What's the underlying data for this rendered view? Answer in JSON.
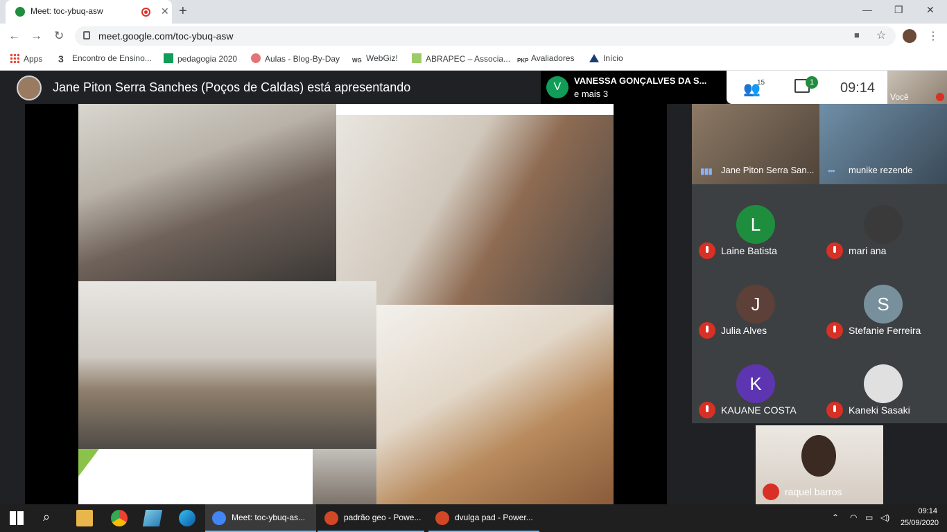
{
  "browser": {
    "tab_title": "Meet: toc-ybuq-asw",
    "tab_close": "✕",
    "new_tab": "+",
    "url": "meet.google.com/toc-ybuq-asw",
    "window_minimize": "—",
    "window_restore": "❐",
    "window_close": "✕"
  },
  "bookmarks": [
    {
      "label": "Apps",
      "icon": "apps-grid-icon"
    },
    {
      "label": "Encontro de Ensino...",
      "icon": "number-3-icon"
    },
    {
      "label": "pedagogia 2020",
      "icon": "sheets-icon"
    },
    {
      "label": "Aulas - Blog-By-Day",
      "icon": "blog-icon"
    },
    {
      "label": "WebGiz!",
      "icon": "wg-icon"
    },
    {
      "label": "ABRAPEC – Associa...",
      "icon": "abrapec-icon"
    },
    {
      "label": "Avaliadores",
      "icon": "pkp-icon"
    },
    {
      "label": "Início",
      "icon": "home-icon"
    }
  ],
  "meet": {
    "presenting_text": "Jane Piton Serra Sanches (Poços de Caldas) está apresentando",
    "chip": {
      "initial": "V",
      "name": "VANESSA GONÇALVES DA S...",
      "more": "e mais 3"
    },
    "people_count": "15",
    "chat_badge": "1",
    "clock": "09:14",
    "self_label": "Você",
    "video_tiles": [
      {
        "name": "Jane Piton Serra San..."
      },
      {
        "name": "munike rezende"
      }
    ],
    "participants": [
      {
        "initial": "L",
        "name": "Laine Batista",
        "color": "#1e8e3e"
      },
      {
        "initial": "",
        "name": "mari ana",
        "color": "#3a3a3a"
      },
      {
        "initial": "J",
        "name": "Julia Alves",
        "color": "#5d4037"
      },
      {
        "initial": "S",
        "name": "Stefanie Ferreira",
        "color": "#78909c"
      },
      {
        "initial": "K",
        "name": "KAUANE COSTA",
        "color": "#5e35b1"
      },
      {
        "initial": "",
        "name": "Kaneki Sasaki",
        "color": "#e0e0e0"
      }
    ],
    "bottom_tile": {
      "name": "raquel barros"
    }
  },
  "taskbar": {
    "apps": [
      {
        "label": "Meet: toc-ybuq-as...",
        "color": "#4285f4"
      },
      {
        "label": "padrão geo - Powe...",
        "color": "#d24726"
      },
      {
        "label": "dvulga pad - Power...",
        "color": "#d24726"
      }
    ],
    "time": "09:14",
    "date": "25/09/2020"
  }
}
